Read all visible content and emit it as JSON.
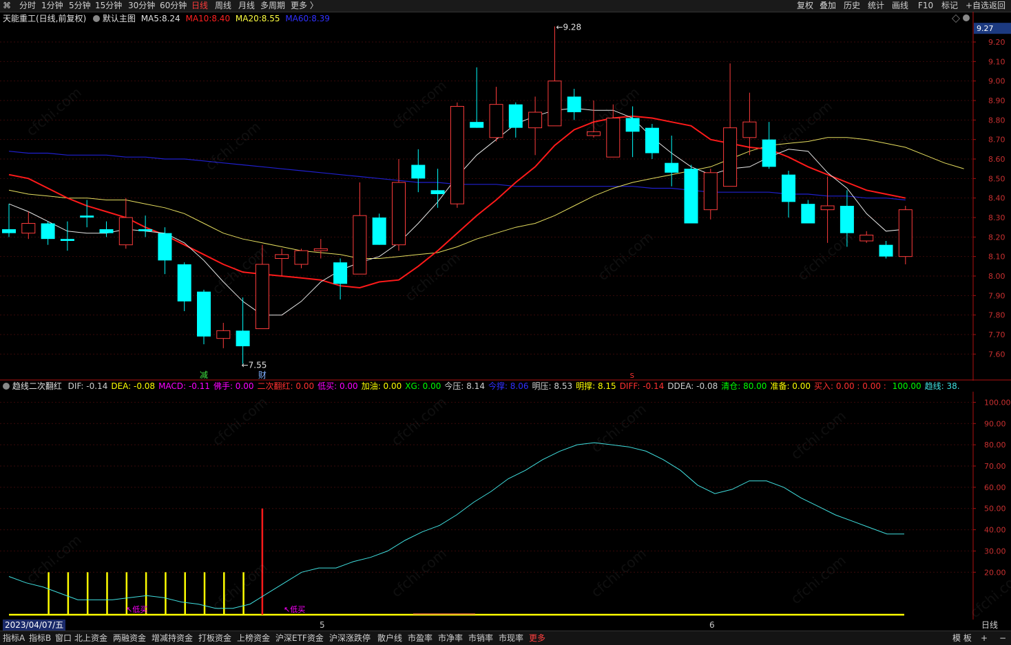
{
  "toolbar": {
    "periods": [
      "分时",
      "1分钟",
      "5分钟",
      "15分钟",
      "30分钟",
      "60分钟",
      "日线",
      "周线",
      "月线",
      "多周期",
      "更多 〉"
    ],
    "active_period": "日线",
    "right": [
      "复权",
      "叠加",
      "历史",
      "统计",
      "画线",
      "F10",
      "标记",
      "+自选",
      "返回"
    ]
  },
  "main_info": {
    "stock": "天能重工(日线,前复权)",
    "template": "默认主图",
    "ma5_label": "MA5:",
    "ma5": "8.24",
    "ma10_label": "MA10:",
    "ma10": "8.40",
    "ma20_label": "MA20:",
    "ma20": "8.55",
    "ma60_label": "MA60:",
    "ma60": "8.39",
    "current_price": "9.27",
    "high_label": "9.28",
    "low_label": "7.55",
    "marker_jian": "减",
    "marker_cai": "财",
    "marker_s": "S"
  },
  "indicator_info": {
    "name": "趋线二次翻红",
    "items": [
      {
        "k": "DIF:",
        "v": "-0.14",
        "c": "#d0d0d0"
      },
      {
        "k": "DEA:",
        "v": "-0.08",
        "c": "#ffff00"
      },
      {
        "k": "MACD:",
        "v": "-0.11",
        "c": "#ff00ff"
      },
      {
        "k": "佛手:",
        "v": "0.00",
        "c": "#ff00ff"
      },
      {
        "k": "二次翻红:",
        "v": "0.00",
        "c": "#ff3030"
      },
      {
        "k": "低买:",
        "v": "0.00",
        "c": "#ff00ff"
      },
      {
        "k": "加油:",
        "v": "0.00",
        "c": "#ffff00"
      },
      {
        "k": "XG:",
        "v": "0.00",
        "c": "#00ff00"
      },
      {
        "k": "今压:",
        "v": "8.14",
        "c": "#d0d0d0"
      },
      {
        "k": "今撑:",
        "v": "8.06",
        "c": "#3030ff"
      },
      {
        "k": "明压:",
        "v": "8.53",
        "c": "#d0d0d0"
      },
      {
        "k": "明撑:",
        "v": "8.15",
        "c": "#ffff00"
      },
      {
        "k": "DIFF:",
        "v": "-0.14",
        "c": "#ff3030"
      },
      {
        "k": "DDEA:",
        "v": "-0.08",
        "c": "#d0d0d0"
      },
      {
        "k": "清仓:",
        "v": "80.00",
        "c": "#00ff00"
      },
      {
        "k": "准备:",
        "v": "0.00",
        "c": "#ffff00"
      },
      {
        "k": "买入:",
        "v": "0.00 : 0.00 :",
        "c": "#ff3030"
      },
      {
        "k": "",
        "v": "100.00",
        "c": "#00ff00"
      },
      {
        "k": "趋线:",
        "v": "38.",
        "c": "#40e0e0"
      }
    ],
    "dike_label": "低买"
  },
  "price_axis": [
    "9.20",
    "9.10",
    "9.00",
    "8.90",
    "8.80",
    "8.70",
    "8.60",
    "8.50",
    "8.40",
    "8.30",
    "8.20",
    "8.10",
    "8.00",
    "7.90",
    "7.80",
    "7.70",
    "7.60"
  ],
  "ind_axis": [
    "100.00",
    "90.00",
    "80.00",
    "70.00",
    "60.00",
    "50.00",
    "40.00",
    "30.00",
    "20.00"
  ],
  "date_bar": {
    "date": "2023/04/07/五",
    "m5": "5",
    "m6": "6",
    "period": "日线"
  },
  "bottom": {
    "items": [
      "指标A",
      "指标B",
      "窗口",
      "北上资金",
      "两融资金",
      "增减持资金",
      "打板资金",
      "上榜资金",
      "沪深ETF资金",
      "沪深涨跌停",
      "散户线",
      "市盈率",
      "市净率",
      "市销率",
      "市现率",
      "更多"
    ],
    "right": [
      "模 板",
      "+",
      "−"
    ]
  },
  "chart_data": {
    "type": "candlestick",
    "title": "天能重工(日线,前复权)",
    "ylim": [
      7.52,
      9.32
    ],
    "candles": [
      {
        "o": 8.24,
        "c": 8.22,
        "h": 8.37,
        "l": 8.2
      },
      {
        "o": 8.22,
        "c": 8.27,
        "h": 8.33,
        "l": 8.19
      },
      {
        "o": 8.27,
        "c": 8.19,
        "h": 8.28,
        "l": 8.16
      },
      {
        "o": 8.19,
        "c": 8.18,
        "h": 8.28,
        "l": 8.13
      },
      {
        "o": 8.31,
        "c": 8.3,
        "h": 8.39,
        "l": 8.25
      },
      {
        "o": 8.24,
        "c": 8.22,
        "h": 8.28,
        "l": 8.2
      },
      {
        "o": 8.16,
        "c": 8.3,
        "h": 8.4,
        "l": 8.14
      },
      {
        "o": 8.24,
        "c": 8.23,
        "h": 8.31,
        "l": 8.2
      },
      {
        "o": 8.22,
        "c": 8.08,
        "h": 8.25,
        "l": 8.01
      },
      {
        "o": 8.06,
        "c": 7.87,
        "h": 8.07,
        "l": 7.82
      },
      {
        "o": 7.92,
        "c": 7.69,
        "h": 7.93,
        "l": 7.65
      },
      {
        "o": 7.68,
        "c": 7.72,
        "h": 7.76,
        "l": 7.63
      },
      {
        "o": 7.72,
        "c": 7.64,
        "h": 7.89,
        "l": 7.55
      },
      {
        "o": 7.73,
        "c": 8.06,
        "h": 8.16,
        "l": 7.73
      },
      {
        "o": 8.09,
        "c": 8.11,
        "h": 8.14,
        "l": 8.0
      },
      {
        "o": 8.06,
        "c": 8.13,
        "h": 8.14,
        "l": 8.04
      },
      {
        "o": 8.13,
        "c": 8.14,
        "h": 8.19,
        "l": 8.09
      },
      {
        "o": 8.07,
        "c": 7.96,
        "h": 8.09,
        "l": 7.88
      },
      {
        "o": 8.01,
        "c": 8.31,
        "h": 8.48,
        "l": 8.01
      },
      {
        "o": 8.3,
        "c": 8.16,
        "h": 8.32,
        "l": 8.16
      },
      {
        "o": 8.16,
        "c": 8.48,
        "h": 8.6,
        "l": 8.13
      },
      {
        "o": 8.57,
        "c": 8.5,
        "h": 8.65,
        "l": 8.43
      },
      {
        "o": 8.44,
        "c": 8.42,
        "h": 8.55,
        "l": 8.35
      },
      {
        "o": 8.37,
        "c": 8.87,
        "h": 8.89,
        "l": 8.35
      },
      {
        "o": 8.79,
        "c": 8.76,
        "h": 9.07,
        "l": 8.76
      },
      {
        "o": 8.71,
        "c": 8.88,
        "h": 8.97,
        "l": 8.69
      },
      {
        "o": 8.88,
        "c": 8.76,
        "h": 8.89,
        "l": 8.71
      },
      {
        "o": 8.76,
        "c": 8.84,
        "h": 8.92,
        "l": 8.62
      },
      {
        "o": 8.77,
        "c": 9.0,
        "h": 9.28,
        "l": 8.77
      },
      {
        "o": 8.92,
        "c": 8.84,
        "h": 8.96,
        "l": 8.8
      },
      {
        "o": 8.72,
        "c": 8.74,
        "h": 8.9,
        "l": 8.71
      },
      {
        "o": 8.61,
        "c": 8.81,
        "h": 8.88,
        "l": 8.61
      },
      {
        "o": 8.81,
        "c": 8.74,
        "h": 8.87,
        "l": 8.61
      },
      {
        "o": 8.76,
        "c": 8.63,
        "h": 8.78,
        "l": 8.6
      },
      {
        "o": 8.58,
        "c": 8.53,
        "h": 8.72,
        "l": 8.46
      },
      {
        "o": 8.55,
        "c": 8.27,
        "h": 8.57,
        "l": 8.27
      },
      {
        "o": 8.34,
        "c": 8.53,
        "h": 8.55,
        "l": 8.29
      },
      {
        "o": 8.46,
        "c": 8.76,
        "h": 9.09,
        "l": 8.46
      },
      {
        "o": 8.71,
        "c": 8.79,
        "h": 8.94,
        "l": 8.62
      },
      {
        "o": 8.7,
        "c": 8.56,
        "h": 8.79,
        "l": 8.55
      },
      {
        "o": 8.52,
        "c": 8.38,
        "h": 8.54,
        "l": 8.3
      },
      {
        "o": 8.37,
        "c": 8.27,
        "h": 8.39,
        "l": 8.27
      },
      {
        "o": 8.34,
        "c": 8.36,
        "h": 8.51,
        "l": 8.17
      },
      {
        "o": 8.36,
        "c": 8.22,
        "h": 8.44,
        "l": 8.15
      },
      {
        "o": 8.18,
        "c": 8.21,
        "h": 8.23,
        "l": 8.17
      },
      {
        "o": 8.16,
        "c": 8.1,
        "h": 8.18,
        "l": 8.09
      },
      {
        "o": 8.1,
        "c": 8.34,
        "h": 8.36,
        "l": 8.06
      }
    ],
    "ma5": [
      8.37,
      8.33,
      8.28,
      8.23,
      8.22,
      8.22,
      8.24,
      8.23,
      8.22,
      8.17,
      8.08,
      7.97,
      7.87,
      7.8,
      7.8,
      7.87,
      7.97,
      8.03,
      8.07,
      8.1,
      8.17,
      8.27,
      8.38,
      8.51,
      8.62,
      8.7,
      8.78,
      8.82,
      8.85,
      8.86,
      8.85,
      8.85,
      8.81,
      8.71,
      8.63,
      8.56,
      8.52,
      8.55,
      8.56,
      8.61,
      8.65,
      8.64,
      8.53,
      8.45,
      8.32,
      8.23,
      8.24
    ],
    "ma10": [
      8.52,
      8.5,
      8.45,
      8.4,
      8.36,
      8.33,
      8.3,
      8.25,
      8.21,
      8.16,
      8.11,
      8.06,
      8.02,
      8.01,
      8.0,
      7.99,
      7.98,
      7.95,
      7.94,
      7.97,
      7.98,
      8.05,
      8.13,
      8.22,
      8.31,
      8.39,
      8.48,
      8.56,
      8.67,
      8.75,
      8.79,
      8.81,
      8.82,
      8.81,
      8.79,
      8.77,
      8.7,
      8.68,
      8.66,
      8.65,
      8.61,
      8.56,
      8.52,
      8.48,
      8.44,
      8.42,
      8.4
    ],
    "ma20": [
      8.44,
      8.42,
      8.41,
      8.4,
      8.4,
      8.39,
      8.39,
      8.37,
      8.35,
      8.32,
      8.27,
      8.22,
      8.19,
      8.17,
      8.15,
      8.13,
      8.12,
      8.11,
      8.09,
      8.09,
      8.1,
      8.11,
      8.12,
      8.15,
      8.19,
      8.22,
      8.25,
      8.27,
      8.31,
      8.36,
      8.41,
      8.45,
      8.48,
      8.5,
      8.52,
      8.54,
      8.56,
      8.6,
      8.64,
      8.67,
      8.68,
      8.69,
      8.71,
      8.71,
      8.7,
      8.68,
      8.66,
      8.62,
      8.58,
      8.55
    ],
    "ma60": [
      8.64,
      8.63,
      8.63,
      8.62,
      8.62,
      8.62,
      8.61,
      8.61,
      8.6,
      8.6,
      8.59,
      8.58,
      8.57,
      8.56,
      8.55,
      8.54,
      8.53,
      8.52,
      8.51,
      8.5,
      8.49,
      8.48,
      8.48,
      8.47,
      8.47,
      8.47,
      8.46,
      8.46,
      8.46,
      8.46,
      8.46,
      8.46,
      8.46,
      8.45,
      8.45,
      8.44,
      8.43,
      8.43,
      8.43,
      8.43,
      8.42,
      8.42,
      8.41,
      8.41,
      8.4,
      8.4,
      8.39
    ],
    "indicator": {
      "ylim": [
        0,
        105
      ],
      "trend_line": [
        18,
        15,
        13,
        10,
        7,
        7,
        7,
        8,
        9,
        8,
        6,
        5,
        3,
        3,
        5,
        10,
        15,
        20,
        22,
        22,
        25,
        27,
        30,
        35,
        39,
        42,
        47,
        53,
        58,
        64,
        68,
        73,
        77,
        80,
        81,
        80,
        79,
        77,
        73,
        68,
        61,
        57,
        59,
        63,
        63,
        60,
        55,
        51,
        47,
        44,
        41,
        38,
        38
      ],
      "spikes_yellow": [
        0,
        0,
        20,
        20,
        20,
        20,
        20,
        20,
        20,
        20,
        20,
        20,
        20,
        0,
        0,
        0,
        0,
        0,
        0,
        0,
        0,
        0,
        0,
        0,
        0,
        0,
        0,
        0,
        0,
        0,
        0,
        0,
        0,
        0,
        0,
        0,
        0,
        0,
        0,
        0,
        0,
        0,
        0,
        0,
        0,
        0,
        0
      ],
      "spike_red_index": 13,
      "spike_red_value": 50
    }
  }
}
